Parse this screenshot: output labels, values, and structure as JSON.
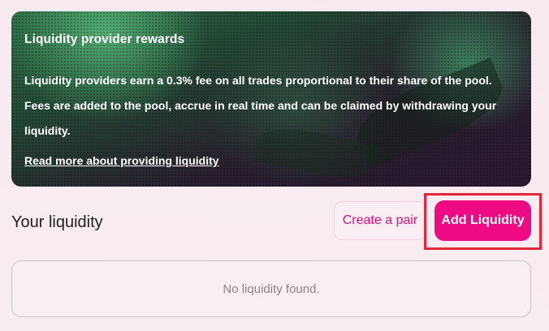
{
  "banner": {
    "title": "Liquidity provider rewards",
    "lines": [
      "Liquidity providers earn a 0.3% fee on all trades proportional to their share of the pool.",
      "Fees are added to the pool, accrue in real time and can be claimed by withdrawing your",
      "liquidity."
    ],
    "link_label": "Read more about providing liquidity"
  },
  "liquidity": {
    "title": "Your liquidity",
    "create_pair_label": "Create a pair",
    "add_liquidity_label": "Add Liquidity",
    "empty_text": "No liquidity found."
  },
  "colors": {
    "accent": "#ee0a83",
    "accent_text": "#e2107b",
    "highlight_frame": "#e3263a"
  }
}
